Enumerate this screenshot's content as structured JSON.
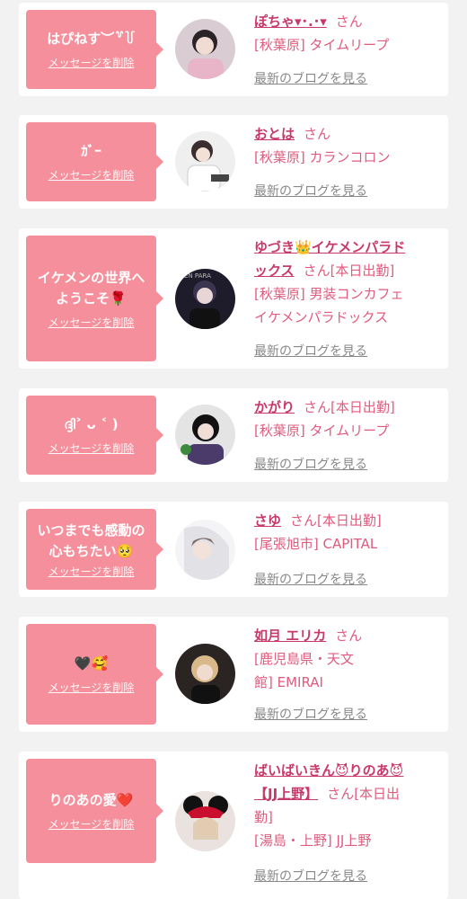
{
  "common": {
    "delete_label": "メッセージを削除",
    "blog_label": "最新のブログを見る",
    "san": "さん"
  },
  "cards": [
    {
      "message": "はぴねす︶꒷꒦",
      "name": "ぽちゃ▾･.･▾",
      "status": "",
      "shop": "[秋葉原] タイムリープ"
    },
    {
      "message": "ｶﾞｰ",
      "name": "おとは",
      "status": "",
      "shop": "[秋葉原] カランコロン"
    },
    {
      "message_line1": "イケメンの世界へ",
      "message_line2": "ようこそ🌹",
      "name_line1": "ゆづき👑イケメンパラド",
      "name_line2": "ックス",
      "status": "[本日出勤]",
      "shop_line1": "[秋葉原] 男装コンカフェ",
      "shop_line2": "イケメンパラドックス"
    },
    {
      "message": "ദ്ദി˃ ᴗ ˂ )",
      "name": "かがり",
      "status": "[本日出勤]",
      "shop": "[秋葉原] タイムリープ"
    },
    {
      "message_line1": "いつまでも感動の",
      "message_line2": "心もちたい🥺",
      "name": "さゆ",
      "status": "[本日出勤]",
      "shop": "[尾張旭市] CAPITAL"
    },
    {
      "message": "🖤🥰",
      "name": "如月 エリカ",
      "status": "",
      "shop_line1": "[鹿児島県・天文",
      "shop_line2": "館] EMIRAI"
    },
    {
      "message": "りのあの愛❤️",
      "name_line1": "ばいばいきん😈りのあ😈",
      "name_line2": "【JJ上野】",
      "status_line1": "[本日出",
      "status_line2": "勤]",
      "shop": "[湯島・上野] JJ上野"
    }
  ]
}
